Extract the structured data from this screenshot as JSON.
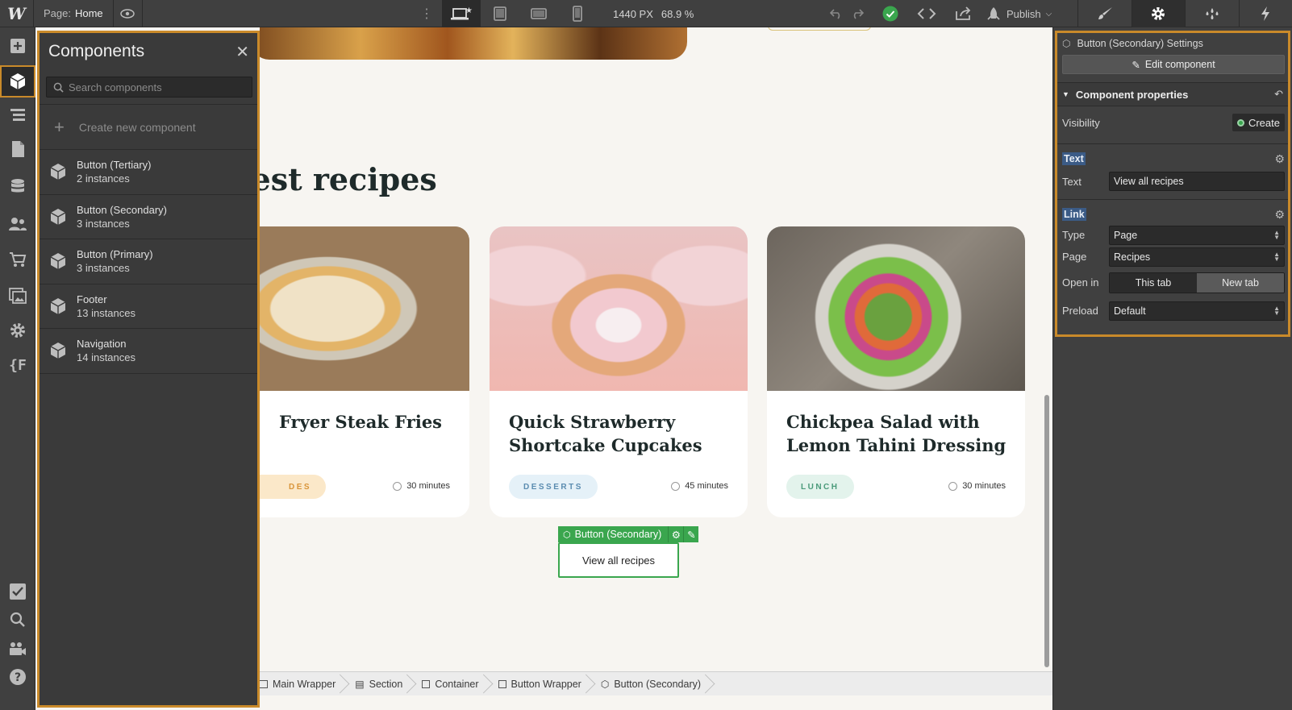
{
  "topbar": {
    "page_label": "Page:",
    "page_name": "Home",
    "width": "1440 PX",
    "zoom": "68.9 %",
    "publish_label": "Publish"
  },
  "components_panel": {
    "title": "Components",
    "search_placeholder": "Search components",
    "create_label": "Create new component",
    "items": [
      {
        "name": "Button (Tertiary)",
        "instances": "2 instances"
      },
      {
        "name": "Button (Secondary)",
        "instances": "3 instances"
      },
      {
        "name": "Button (Primary)",
        "instances": "3 instances"
      },
      {
        "name": "Footer",
        "instances": "13 instances"
      },
      {
        "name": "Navigation",
        "instances": "14 instances"
      }
    ]
  },
  "canvas": {
    "section_title": "test recipes",
    "cards": [
      {
        "title": "Fryer Steak Fries",
        "tag": "DES",
        "time": "30 minutes"
      },
      {
        "title": "Quick Strawberry Shortcake Cupcakes",
        "tag": "DESSERTS",
        "time": "45 minutes"
      },
      {
        "title": "Chickpea Salad with Lemon Tahini Dressing",
        "tag": "LUNCH",
        "time": "30 minutes"
      }
    ],
    "selected_label": "Button (Secondary)",
    "button_text": "View all recipes"
  },
  "breadcrumbs": [
    "Main Wrapper",
    "Section",
    "Container",
    "Button Wrapper",
    "Button (Secondary)"
  ],
  "settings": {
    "title": "Button (Secondary) Settings",
    "edit_label": "Edit component",
    "props_header": "Component properties",
    "visibility_label": "Visibility",
    "visibility_value": "Create",
    "text_section": "Text",
    "text_label": "Text",
    "text_value": "View all recipes",
    "link_section": "Link",
    "type_label": "Type",
    "type_value": "Page",
    "page_label": "Page",
    "page_value": "Recipes",
    "openin_label": "Open in",
    "openin_this": "This tab",
    "openin_new": "New tab",
    "preload_label": "Preload",
    "preload_value": "Default"
  },
  "colors": {
    "accent_orange": "#c98a2a",
    "selection_green": "#3aa64e",
    "panel_dark": "#404040"
  }
}
